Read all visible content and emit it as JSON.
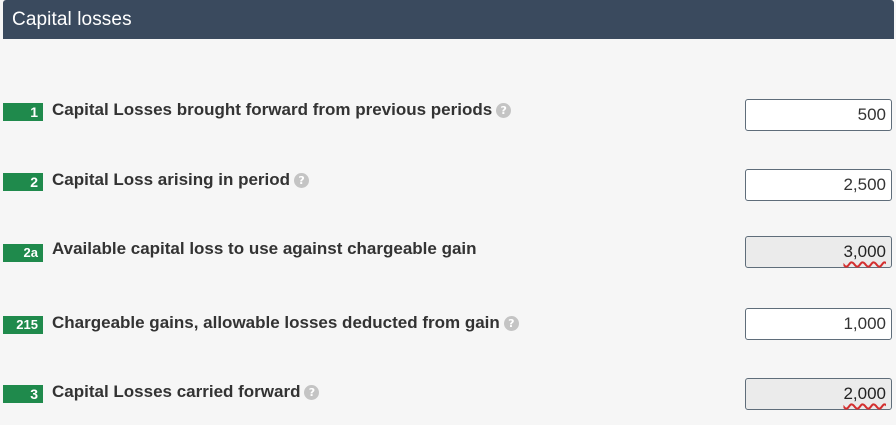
{
  "header": {
    "title": "Capital losses"
  },
  "rows": [
    {
      "box": "1",
      "label": "Capital Losses brought forward from previous periods",
      "help": "?",
      "value": "500",
      "readonly": false
    },
    {
      "box": "2",
      "label": "Capital Loss arising in period",
      "help": "?",
      "value": "2,500",
      "readonly": false
    },
    {
      "box": "2a",
      "label": "Available capital loss to use against chargeable gain",
      "value": "3,000",
      "readonly": true
    },
    {
      "box": "215",
      "label": "Chargeable gains, allowable losses deducted from gain",
      "help": "?",
      "value": "1,000",
      "readonly": false
    },
    {
      "box": "3",
      "label": "Capital Losses carried forward",
      "help": "?",
      "value": "2,000",
      "readonly": true
    }
  ],
  "colors": {
    "header_bg": "#3a4a5e",
    "badge_bg": "#1f8a4c",
    "error_underline": "#d32f2f"
  }
}
